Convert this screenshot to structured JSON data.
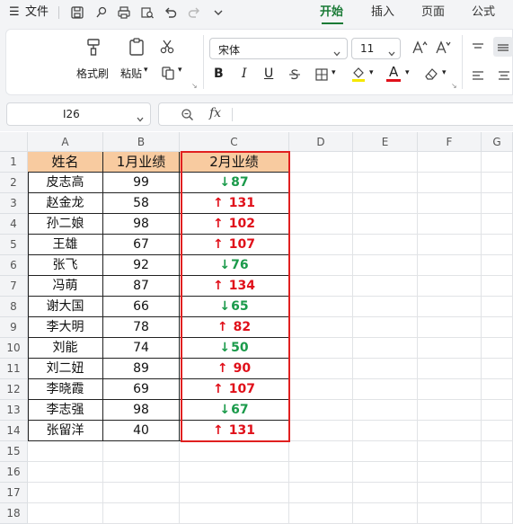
{
  "menu": {
    "hamburger": "☰",
    "file": "文件",
    "tabs": [
      {
        "label": "开始",
        "active": true
      },
      {
        "label": "插入",
        "active": false
      },
      {
        "label": "页面",
        "active": false
      },
      {
        "label": "公式",
        "active": false
      }
    ]
  },
  "ribbon": {
    "format_painter": "格式刷",
    "paste": "粘贴",
    "font_name": "宋体",
    "font_size": "11",
    "bold": "B",
    "italic": "I",
    "underline": "U",
    "font_color_letter": "A"
  },
  "formula_bar": {
    "cell_ref": "I26",
    "fx": "fx",
    "formula": ""
  },
  "sheet": {
    "columns": [
      "A",
      "B",
      "C",
      "D",
      "E",
      "F",
      "G"
    ],
    "rows": [
      "1",
      "2",
      "3",
      "4",
      "5",
      "6",
      "7",
      "8",
      "9",
      "10",
      "11",
      "12",
      "13",
      "14",
      "15",
      "16",
      "17",
      "18"
    ],
    "header": {
      "name": "姓名",
      "jan": "1月业绩",
      "feb": "2月业绩"
    },
    "data": [
      {
        "name": "皮志高",
        "jan": "99",
        "arrow": "↓",
        "feb": "87",
        "trend": "down"
      },
      {
        "name": "赵金龙",
        "jan": "58",
        "arrow": "↑",
        "feb": "131",
        "trend": "up"
      },
      {
        "name": "孙二娘",
        "jan": "98",
        "arrow": "↑",
        "feb": "102",
        "trend": "up"
      },
      {
        "name": "王雄",
        "jan": "67",
        "arrow": "↑",
        "feb": "107",
        "trend": "up"
      },
      {
        "name": "张飞",
        "jan": "92",
        "arrow": "↓",
        "feb": "76",
        "trend": "down"
      },
      {
        "name": "冯萌",
        "jan": "87",
        "arrow": "↑",
        "feb": "134",
        "trend": "up"
      },
      {
        "name": "谢大国",
        "jan": "66",
        "arrow": "↓",
        "feb": "65",
        "trend": "down"
      },
      {
        "name": "李大明",
        "jan": "78",
        "arrow": "↑",
        "feb": "82",
        "trend": "up"
      },
      {
        "name": "刘能",
        "jan": "74",
        "arrow": "↓",
        "feb": "50",
        "trend": "down"
      },
      {
        "name": "刘二妞",
        "jan": "89",
        "arrow": "↑",
        "feb": "90",
        "trend": "up"
      },
      {
        "name": "李晓霞",
        "jan": "69",
        "arrow": "↑",
        "feb": "107",
        "trend": "up"
      },
      {
        "name": "李志强",
        "jan": "98",
        "arrow": "↓",
        "feb": "67",
        "trend": "down"
      },
      {
        "name": "张留洋",
        "jan": "40",
        "arrow": "↑",
        "feb": "131",
        "trend": "up"
      }
    ]
  },
  "colors": {
    "accent_green": "#1a7a36",
    "header_fill": "#f8cba0",
    "up_red": "#e0101a",
    "down_green": "#1a9a4a",
    "highlight_border": "#e02020"
  }
}
